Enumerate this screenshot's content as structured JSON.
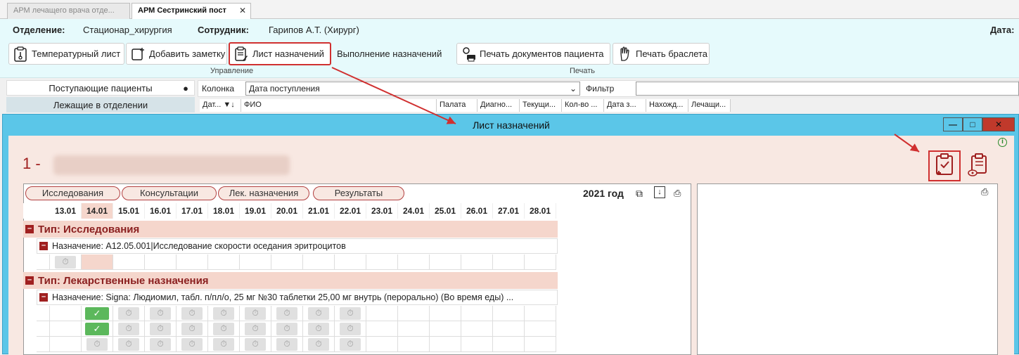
{
  "tabs": [
    {
      "label": "АРМ лечащего врача отде..."
    },
    {
      "label": "АРМ Сестринский пост"
    }
  ],
  "header": {
    "department_label": "Отделение:",
    "department_value": "Стационар_хирургия",
    "employee_label": "Сотрудник:",
    "employee_value": "Гарипов А.Т. (Хирург)",
    "date_label": "Дата:"
  },
  "toolbar": {
    "buttons": [
      {
        "label": "Температурный лист",
        "icon": "thermometer-sheet-icon"
      },
      {
        "label": "Добавить заметку",
        "icon": "add-note-icon"
      },
      {
        "label": "Лист назначений",
        "icon": "prescription-sheet-icon"
      },
      {
        "label": "Выполнение назначений"
      },
      {
        "label": "Печать документов пациента",
        "icon": "printer-user-icon"
      },
      {
        "label": "Печать браслета",
        "icon": "hand-icon"
      }
    ],
    "group_manage": "Управление",
    "group_print": "Печать"
  },
  "left": {
    "incoming": "Поступающие пациенты",
    "lying": "Лежащие в отделении"
  },
  "filter": {
    "column_label": "Колонка",
    "column_value": "Дата поступления",
    "filter_label": "Фильтр"
  },
  "grid_columns": [
    "Дат...",
    "ФИО",
    "Палата",
    "Диагно...",
    "Текущи...",
    "Кол-во ...",
    "Дата з...",
    "Нахожд...",
    "Лечащи..."
  ],
  "modal": {
    "title": "Лист назначений",
    "patient_prefix": "1 -",
    "pills": [
      "Исследования",
      "Консультации",
      "Лек. назначения",
      "Результаты"
    ],
    "year": "2021 год",
    "dates": [
      "13.01",
      "14.01",
      "15.01",
      "16.01",
      "17.01",
      "18.01",
      "19.01",
      "20.01",
      "21.01",
      "22.01",
      "23.01",
      "24.01",
      "25.01",
      "26.01",
      "27.01",
      "28.01"
    ],
    "type1": "Тип: Исследования",
    "assign1": "Назначение: A12.05.001|Исследование скорости оседания эритроцитов",
    "type2": "Тип: Лекарственные назначения",
    "assign2": "Назначение: Signa: Людиомил, табл. п/пл/о, 25 мг №30 таблетки 25,00 мг  внутрь (перорально) (Во время еды)   ..."
  },
  "colors": {
    "accent": "#5bc6e8",
    "highlight": "#d03030",
    "header_bg": "#e6fafc",
    "modal_body": "#f8e8e2"
  }
}
